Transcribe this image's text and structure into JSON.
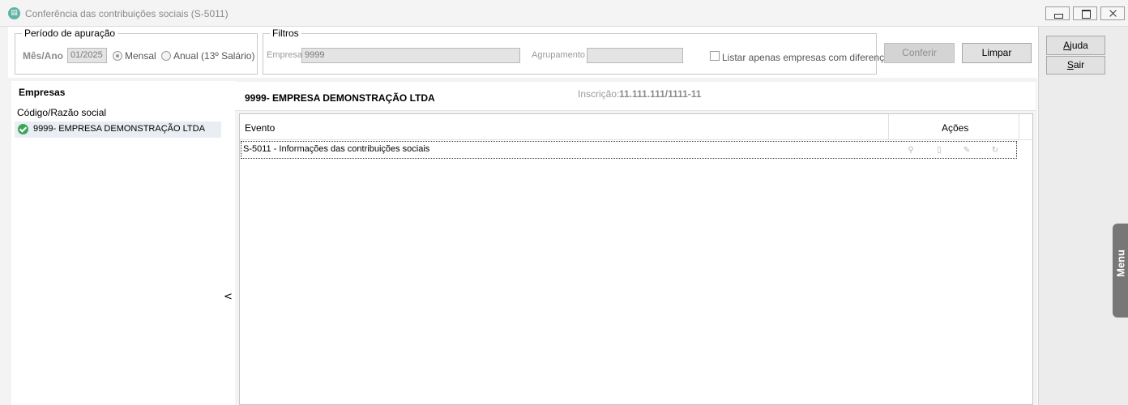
{
  "window": {
    "title": "Conferência das contribuições sociais (S-5011)",
    "app_icon": "document-icon"
  },
  "periodo": {
    "legend": "Período de apuração",
    "mes_ano_label": "Mês/Ano",
    "mes_ano_value": "01/2025",
    "mensal_label": "Mensal",
    "anual_label": "Anual (13º Salário)",
    "selected": "Mensal"
  },
  "filtros": {
    "legend": "Filtros",
    "empresa_label": "Empresa",
    "empresa_value": "9999",
    "agrupamento_label": "Agrupamento",
    "agrupamento_value": "",
    "listar_label": "Listar apenas empresas com diferença"
  },
  "buttons": {
    "conferir": "Conferir",
    "limpar": "Limpar",
    "ajuda_u": "A",
    "ajuda_rest": "juda",
    "sair_u": "S",
    "sair_rest": "air"
  },
  "empresas": {
    "title": "Empresas",
    "column_label": "Código/Razão social",
    "items": [
      {
        "label": "9999- EMPRESA DEMONSTRAÇÃO LTDA",
        "status": "ok"
      }
    ],
    "collapse_glyph": "<"
  },
  "detalhe": {
    "company_title": "9999- EMPRESA DEMONSTRAÇÃO LTDA",
    "inscricao_label": "Inscrição:",
    "inscricao_value": "11.111.111/1111-11"
  },
  "grid": {
    "columns": [
      "Evento",
      "Ações"
    ],
    "rows": [
      {
        "evento": "S-5011 - Informações das contribuições sociais",
        "actions": [
          "search-icon",
          "document-icon",
          "edit-icon",
          "refresh-icon"
        ]
      }
    ]
  },
  "side_menu": {
    "label": "Menu"
  }
}
